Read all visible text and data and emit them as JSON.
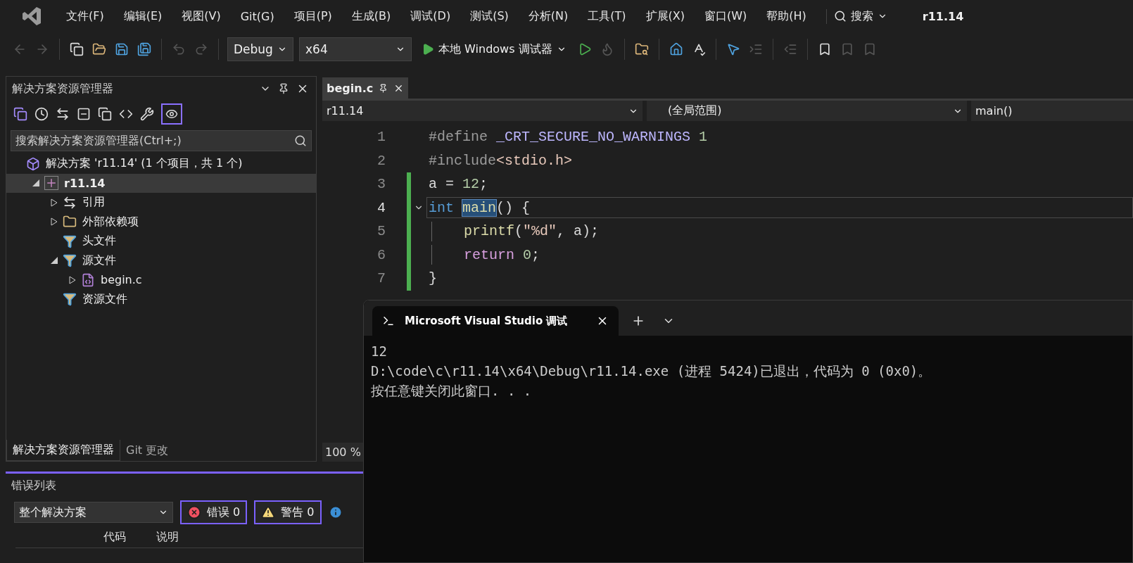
{
  "menu": [
    {
      "label": "文件(F)"
    },
    {
      "label": "编辑(E)"
    },
    {
      "label": "视图(V)"
    },
    {
      "label": "Git(G)"
    },
    {
      "label": "项目(P)"
    },
    {
      "label": "生成(B)"
    },
    {
      "label": "调试(D)"
    },
    {
      "label": "测试(S)"
    },
    {
      "label": "分析(N)"
    },
    {
      "label": "工具(T)"
    },
    {
      "label": "扩展(X)"
    },
    {
      "label": "窗口(W)"
    },
    {
      "label": "帮助(H)"
    }
  ],
  "search": {
    "label": "搜索"
  },
  "window": {
    "title": "r11.14"
  },
  "toolbar": {
    "configuration": "Debug",
    "platform": "x64",
    "run_label": "本地 Windows 调试器"
  },
  "solution_explorer": {
    "title": "解决方案资源管理器",
    "preview_toggle": {
      "selected": true
    },
    "search": {
      "placeholder": "搜索解决方案资源管理器(Ctrl+;)"
    },
    "tree": [
      {
        "label": "解决方案 'r11.14' (1 个项目，共 1 个)",
        "kind": "solution",
        "selected": false,
        "children": [
          {
            "label": "r11.14",
            "kind": "project",
            "expanded": true,
            "selected": true,
            "children": [
              {
                "label": "引用",
                "kind": "references",
                "expanded": false,
                "selected": false
              },
              {
                "label": "外部依赖项",
                "kind": "external",
                "expanded": false,
                "selected": false
              },
              {
                "label": "头文件",
                "kind": "filter",
                "selected": false
              },
              {
                "label": "源文件",
                "kind": "filter",
                "expanded": true,
                "selected": false,
                "children": [
                  {
                    "label": "begin.c",
                    "kind": "c-file",
                    "expanded": false,
                    "selected": false
                  }
                ]
              },
              {
                "label": "资源文件",
                "kind": "filter",
                "selected": false
              }
            ]
          }
        ]
      }
    ],
    "bottom_tabs": [
      {
        "label": "解决方案资源管理器",
        "selected": true
      },
      {
        "label": "Git 更改",
        "selected": false
      }
    ]
  },
  "editor": {
    "tabs": [
      {
        "label": "begin.c",
        "selected": true
      }
    ],
    "nav": {
      "project": "r11.14",
      "scope": "(全局范围)",
      "member": "main()"
    },
    "lines": [
      {
        "number": "1",
        "changed": false,
        "current": false,
        "in_block": false,
        "tokens": [
          {
            "text": "#define ",
            "kind": "directive"
          },
          {
            "text": "_CRT_SECURE_NO_WARNINGS",
            "kind": "macro"
          },
          {
            "text": " 1",
            "kind": "number"
          }
        ]
      },
      {
        "number": "2",
        "changed": false,
        "current": false,
        "in_block": false,
        "tokens": [
          {
            "text": "#include",
            "kind": "directive"
          },
          {
            "text": "<stdio.h>",
            "kind": "header"
          }
        ]
      },
      {
        "number": "3",
        "changed": true,
        "current": false,
        "in_block": false,
        "tokens": [
          {
            "text": "a = ",
            "kind": "plain"
          },
          {
            "text": "12",
            "kind": "number"
          },
          {
            "text": ";",
            "kind": "plain"
          }
        ]
      },
      {
        "number": "4",
        "changed": true,
        "current": true,
        "in_block": false,
        "foldable": true,
        "tokens": [
          {
            "text": "int ",
            "kind": "keyword"
          },
          {
            "text": "main",
            "kind": "function",
            "highlighted": true
          },
          {
            "text": "() {",
            "kind": "plain"
          }
        ]
      },
      {
        "number": "5",
        "changed": true,
        "current": false,
        "in_block": true,
        "tokens": [
          {
            "text": "printf",
            "kind": "function"
          },
          {
            "text": "(",
            "kind": "plain"
          },
          {
            "text": "\"%d\"",
            "kind": "string"
          },
          {
            "text": ", a);",
            "kind": "plain"
          }
        ]
      },
      {
        "number": "6",
        "changed": true,
        "current": false,
        "in_block": true,
        "tokens": [
          {
            "text": "return ",
            "kind": "control"
          },
          {
            "text": "0",
            "kind": "number"
          },
          {
            "text": ";",
            "kind": "plain"
          }
        ]
      },
      {
        "number": "7",
        "changed": true,
        "current": false,
        "in_block": false,
        "tokens": [
          {
            "text": "}",
            "kind": "plain"
          }
        ]
      }
    ],
    "zoom": "100 %"
  },
  "error_list": {
    "title": "错误列表",
    "scope": "整个解决方案",
    "filters": [
      {
        "kind": "error",
        "label": "错误 0",
        "selected": true
      },
      {
        "kind": "warning",
        "label": "警告 0",
        "selected": true
      }
    ],
    "columns": [
      "代码",
      "说明"
    ]
  },
  "terminal": {
    "tab_title": "Microsoft Visual Studio 调试",
    "output": [
      "12",
      "D:\\code\\c\\r11.14\\x64\\Debug\\r11.14.exe (进程 5424)已退出，代码为 0 (0x0)。",
      "按任意键关闭此窗口. . ."
    ]
  }
}
